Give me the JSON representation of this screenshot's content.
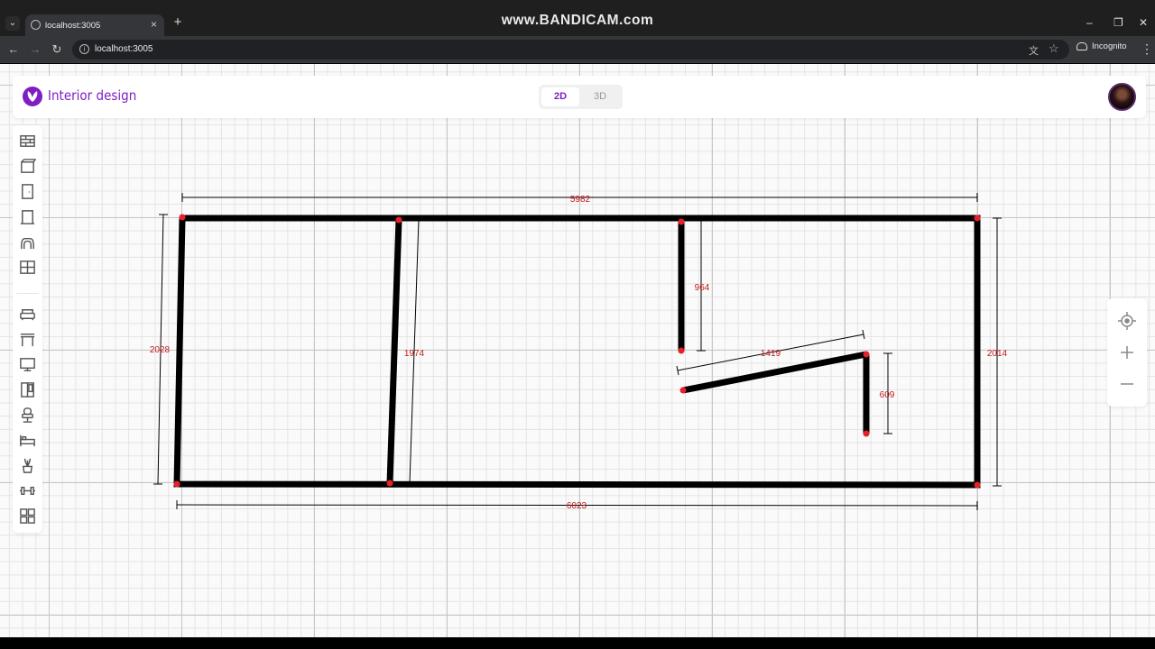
{
  "browser": {
    "tab_title": "localhost:3005",
    "url": "localhost:3005",
    "watermark": "www.BANDICAM.com",
    "incognito_label": "Incognito"
  },
  "app": {
    "title": "Interior design",
    "brand_color": "#7e1fc4",
    "view_modes": [
      "2D",
      "3D"
    ],
    "active_view": "2D"
  },
  "left_toolbar": [
    {
      "name": "wall-icon"
    },
    {
      "name": "room-icon"
    },
    {
      "name": "door-icon"
    },
    {
      "name": "doorway-icon"
    },
    {
      "name": "arch-icon"
    },
    {
      "name": "window-icon"
    },
    {
      "name": "sofa-icon"
    },
    {
      "name": "table-icon"
    },
    {
      "name": "tv-icon"
    },
    {
      "name": "wardrobe-icon"
    },
    {
      "name": "chair-icon"
    },
    {
      "name": "bed-icon"
    },
    {
      "name": "plant-icon"
    },
    {
      "name": "dumbbell-icon"
    },
    {
      "name": "grid-apps-icon"
    }
  ],
  "right_toolbar": [
    {
      "name": "locate-icon"
    },
    {
      "name": "zoom-in-icon"
    },
    {
      "name": "zoom-out-icon"
    }
  ],
  "floor_plan": {
    "wall_color": "#000000",
    "node_color": "#e8202a",
    "dimension_color": "#c41a1a",
    "dimensions": {
      "top": "5982",
      "bottom": "6023",
      "left": "2028",
      "right": "2014",
      "partition": "1974",
      "short_wall": "964",
      "slanted_wall": "1419",
      "stub_wall": "609"
    }
  }
}
